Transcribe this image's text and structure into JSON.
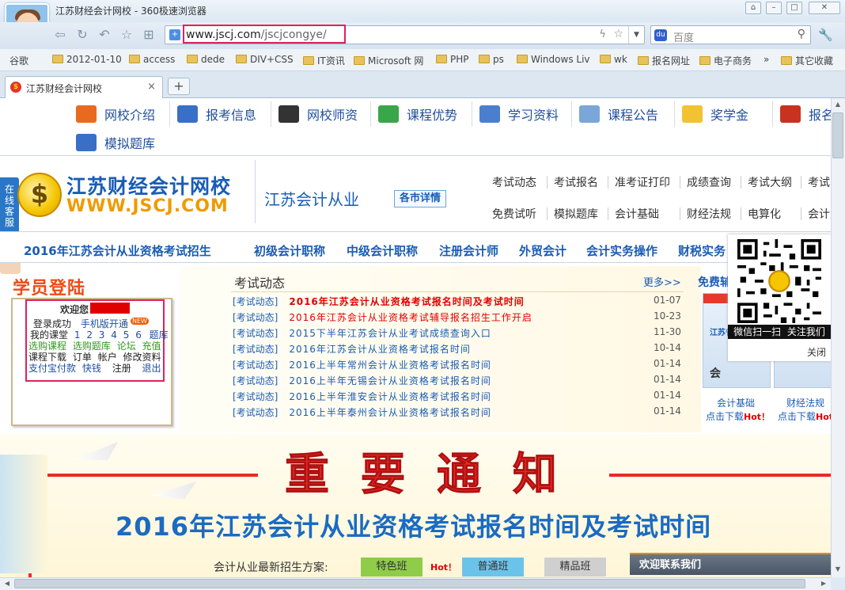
{
  "window": {
    "title": "江苏财经会计网校 - 360极速浏览器",
    "controls": [
      "⌂",
      "–",
      "□",
      "✕"
    ]
  },
  "navbar": {
    "back": "⇦",
    "refresh": "↻",
    "undo": "↶",
    "favorite": "☆",
    "apps": "⊞",
    "url_host": "www.jscj.com",
    "url_path": "/jscjcongye/",
    "search_placeholder": "百度"
  },
  "bookmarks": [
    {
      "label": "谷歌",
      "folder": false
    },
    {
      "label": "2012-01-10",
      "folder": true
    },
    {
      "label": "access",
      "folder": true
    },
    {
      "label": "dede",
      "folder": true
    },
    {
      "label": "DIV+CSS",
      "folder": true
    },
    {
      "label": "IT资讯",
      "folder": true
    },
    {
      "label": "Microsoft 网",
      "folder": true
    },
    {
      "label": "PHP",
      "folder": true
    },
    {
      "label": "ps",
      "folder": true
    },
    {
      "label": "Windows Liv",
      "folder": true
    },
    {
      "label": "wk",
      "folder": true
    },
    {
      "label": "报名网址",
      "folder": true
    },
    {
      "label": "电子商务",
      "folder": true
    },
    {
      "label": "»",
      "folder": false
    },
    {
      "label": "其它收藏",
      "folder": true
    }
  ],
  "tab": {
    "title": "江苏财经会计网校",
    "close": "×",
    "new": "+"
  },
  "topnav": [
    {
      "label": "网校介绍",
      "icon": "house-icon"
    },
    {
      "label": "报考信息",
      "icon": "grid-icon"
    },
    {
      "label": "网校师资",
      "icon": "teacher-icon"
    },
    {
      "label": "课程优势",
      "icon": "chart-icon"
    },
    {
      "label": "学习资料",
      "icon": "pencil-icon"
    },
    {
      "label": "课程公告",
      "icon": "window-icon"
    },
    {
      "label": "奖学金",
      "icon": "coins-icon"
    },
    {
      "label": "报名",
      "icon": "cart-icon"
    },
    {
      "label": "模拟题库",
      "icon": "list-icon"
    }
  ],
  "logo": {
    "cn": "江苏财经会计网校",
    "en": "WWW.JSCJ.COM",
    "symbol": "$"
  },
  "site_title": "江苏会计从业",
  "city_button": "各市详情",
  "quicklinks_row1": [
    "考试动态",
    "考试报名",
    "准考证打印",
    "成绩查询",
    "考试大纲",
    "考试"
  ],
  "quicklinks_row2": [
    "免费试听",
    "模拟题库",
    "会计基础",
    "财经法规",
    "电算化",
    "会计从业"
  ],
  "bluenav": [
    "2016年江苏会计从业资格考试招生",
    "初级会计职称",
    "中级会计职称",
    "注册会计师",
    "外贸会计",
    "会计实务操作",
    "财税实务"
  ],
  "kefu": "在线客服",
  "login": {
    "title": "学员登陆",
    "welcome": "欢迎您",
    "new_badge": "NEW",
    "row1": [
      "登录成功",
      "手机版开通"
    ],
    "row2": [
      "我的课堂",
      "1",
      "2",
      "3",
      "4",
      "5",
      "6",
      "题库"
    ],
    "row3": [
      "选购课程",
      "选购题库",
      "论坛",
      "充值"
    ],
    "row4": [
      "课程下载",
      "订单",
      "帐户",
      "修改资料"
    ],
    "row5": [
      "支付宝付款",
      "快钱",
      "注册",
      "退出"
    ]
  },
  "news": {
    "title": "考试动态",
    "more": "更多>>",
    "items": [
      {
        "tag": "[考试动态]",
        "text": "2016年江苏会计从业资格考试报名时间及考试时间",
        "date": "01-07",
        "style": "hot"
      },
      {
        "tag": "[考试动态]",
        "text": "2016年江苏会计从业资格考试辅导报名招生工作开启",
        "date": "10-23",
        "style": "red"
      },
      {
        "tag": "[考试动态]",
        "text": "2015下半年江苏会计从业考试成绩查询入口",
        "date": "11-30",
        "style": ""
      },
      {
        "tag": "[考试动态]",
        "text": "2016年江苏会计从业资格考试报名时间",
        "date": "10-14",
        "style": ""
      },
      {
        "tag": "[考试动态]",
        "text": "2016上半年常州会计从业资格考试报名时间",
        "date": "01-14",
        "style": ""
      },
      {
        "tag": "[考试动态]",
        "text": "2016上半年无锡会计从业资格考试报名时间",
        "date": "01-14",
        "style": ""
      },
      {
        "tag": "[考试动态]",
        "text": "2016上半年淮安会计从业资格考试报名时间",
        "date": "01-14",
        "style": ""
      },
      {
        "tag": "[考试动态]",
        "text": "2016上半年泰州会计从业资格考试报名时间",
        "date": "01-14",
        "style": ""
      }
    ]
  },
  "free": {
    "title": "免费辅",
    "book1_label": "江苏省",
    "book1_sub": "会",
    "dl": [
      {
        "name": "会计基础",
        "action": "点击下载",
        "hot": "Hot！"
      },
      {
        "name": "财经法规",
        "action": "点击下载",
        "hot": "Hot"
      }
    ]
  },
  "qr": {
    "scan": "微信扫一扫",
    "follow": "关注我们",
    "close": "关闭"
  },
  "banner": {
    "notice": "重要通知",
    "headline": "2016年江苏会计从业资格考试报名时间及考试时间",
    "plan_label": "会计从业最新招生方案:",
    "buttons": [
      "特色班",
      "普通班",
      "精品班"
    ],
    "hot": "Hot！"
  },
  "contact": "欢迎联系我们",
  "colors": {
    "brand_blue": "#1a5cb5",
    "alert_red": "#e62b26",
    "highlight_pink": "#e0215b",
    "orange": "#ef4a16"
  }
}
